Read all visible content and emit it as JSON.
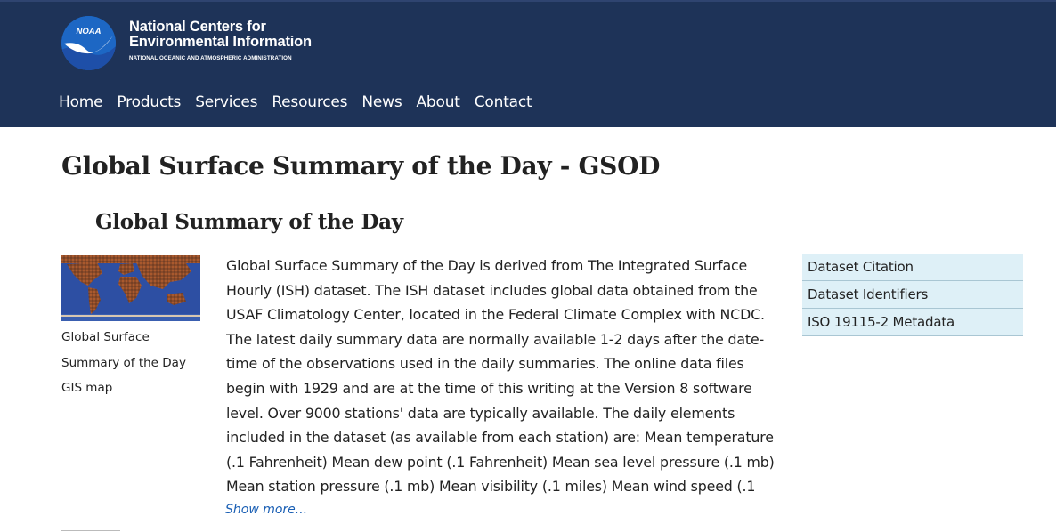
{
  "brand": {
    "line1": "National Centers for",
    "line2": "Environmental Information",
    "line3": "NATIONAL OCEANIC AND ATMOSPHERIC ADMINISTRATION",
    "logo_text": "NOAA",
    "logo_icon": "noaa-logo-icon"
  },
  "nav": [
    "Home",
    "Products",
    "Services",
    "Resources",
    "News",
    "About",
    "Contact"
  ],
  "page_title": "Global Surface Summary of the Day - GSOD",
  "section_title": "Global Summary of the Day",
  "map_caption": "Global Surface Summary of the Day GIS map",
  "description": "Global Surface Summary of the Day is derived from The Integrated Surface Hourly (ISH) dataset. The ISH dataset includes global data obtained from the USAF Climatology Center, located in the Federal Climate Complex with NCDC. The latest daily summary data are normally available 1-2 days after the date-time of the observations used in the daily summaries. The online data files begin with 1929 and are at the time of this writing at the Version 8 software level. Over 9000 stations' data are typically available. The daily elements included in the dataset (as available from each station) are: Mean temperature (.1 Fahrenheit) Mean dew point (.1 Fahrenheit) Mean sea level pressure (.1 mb) Mean station pressure (.1 mb) Mean visibility (.1 miles) Mean wind speed (.1",
  "show_more": "Show more...",
  "side_links": [
    "Dataset Citation",
    "Dataset Identifiers",
    "ISO 19115-2 Metadata"
  ],
  "colors": {
    "header_bg": "#1e3358",
    "link_blue": "#1a5fb4",
    "side_link_bg": "#def0f7",
    "logo_blue": "#1d67c4"
  }
}
